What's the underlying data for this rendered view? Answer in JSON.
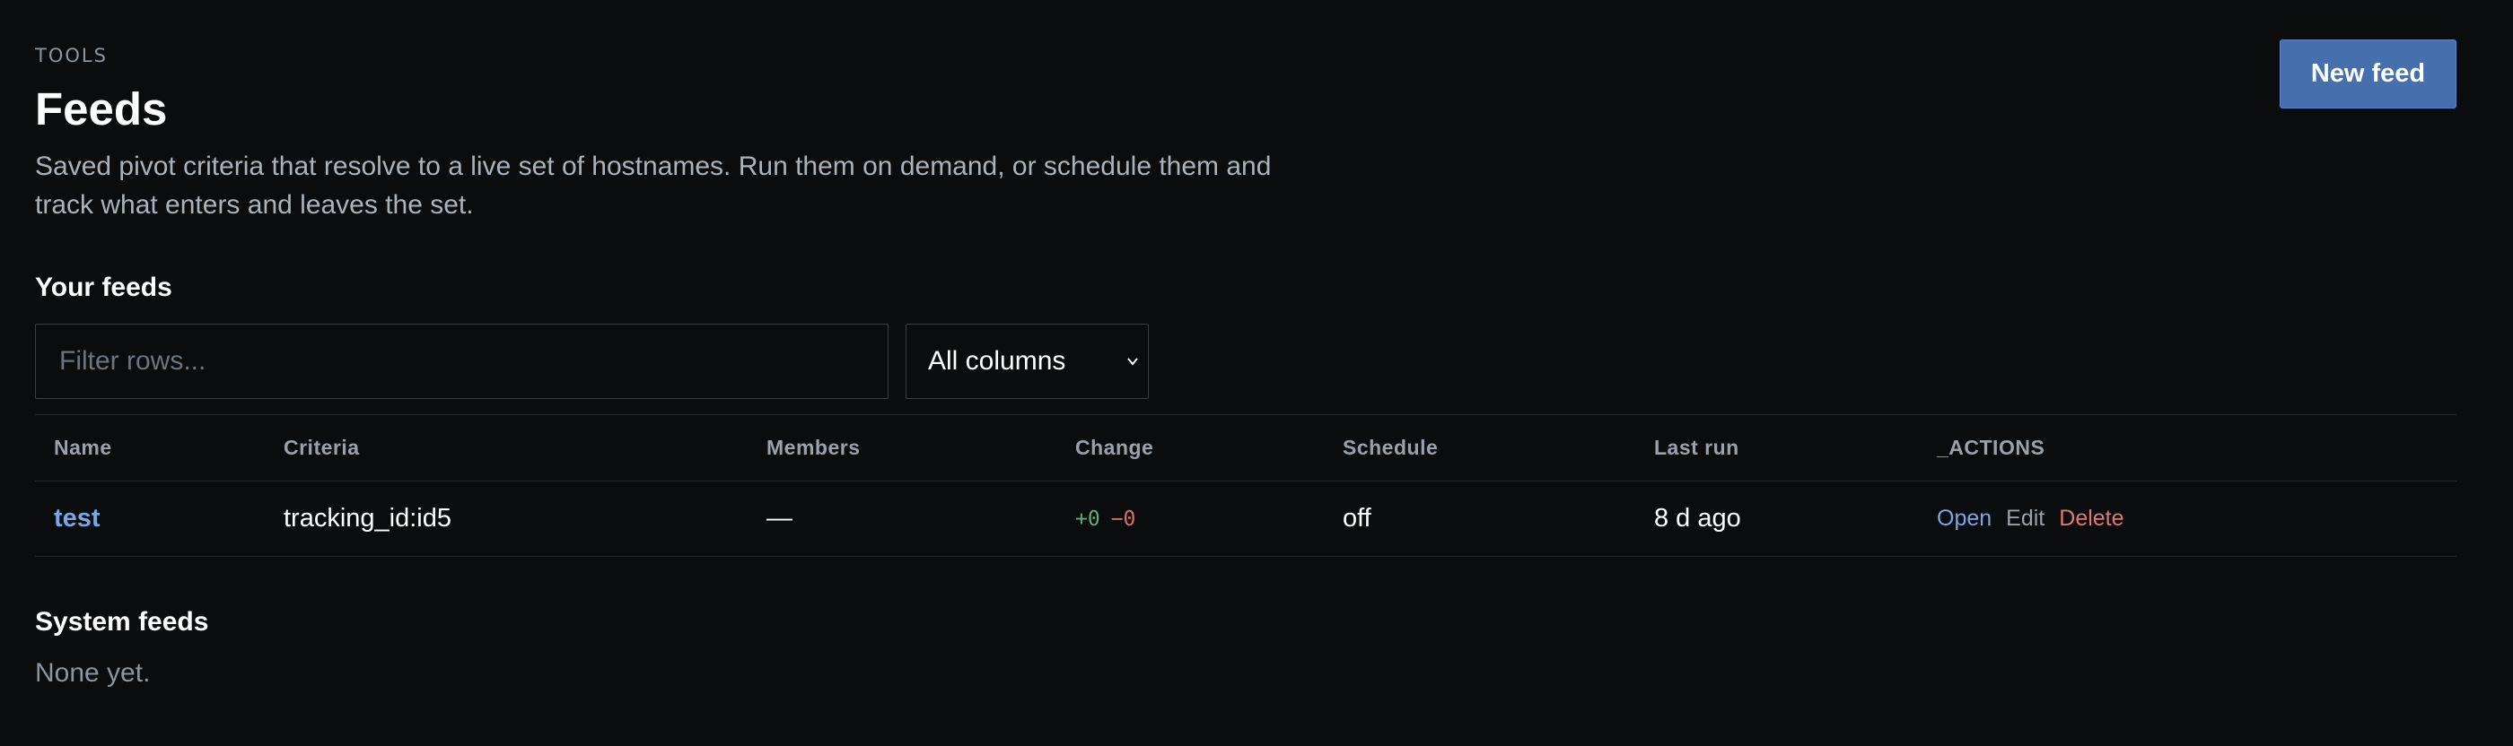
{
  "header": {
    "eyebrow": "TOOLS",
    "title": "Feeds",
    "description": "Saved pivot criteria that resolve to a live set of hostnames. Run them on demand, or schedule them and track what enters and leaves the set.",
    "new_button_label": "New feed"
  },
  "your_feeds": {
    "title": "Your feeds",
    "filter_placeholder": "Filter rows...",
    "column_select_value": "All columns",
    "columns": {
      "name": "Name",
      "criteria": "Criteria",
      "members": "Members",
      "change": "Change",
      "schedule": "Schedule",
      "last_run": "Last run",
      "actions": "_ACTIONS"
    },
    "rows": [
      {
        "name": "test",
        "criteria": "tracking_id:id5",
        "members": "—",
        "change_plus": "+0",
        "change_minus": "−0",
        "schedule": "off",
        "last_run": "8 d ago",
        "action_open": "Open",
        "action_edit": "Edit",
        "action_delete": "Delete"
      }
    ]
  },
  "system_feeds": {
    "title": "System feeds",
    "empty_text": "None yet."
  },
  "colors": {
    "background": "#0b0c0e",
    "primary_button": "#4670ad",
    "link": "#7aa6e6",
    "positive": "#5fae78",
    "negative": "#e06b6b"
  }
}
